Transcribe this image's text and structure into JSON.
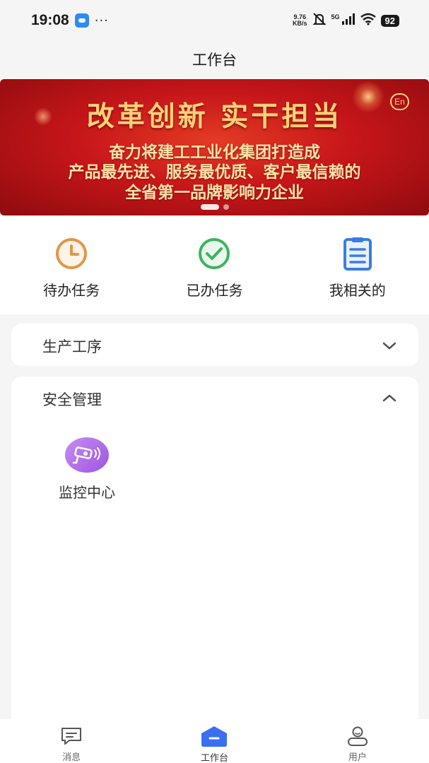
{
  "status_bar": {
    "time": "19:08",
    "more": "···",
    "net_speed_value": "9.76",
    "net_speed_unit": "KB/s",
    "network": "5G",
    "battery": "92"
  },
  "header": {
    "title": "工作台"
  },
  "banner": {
    "headline": "改革创新 实干担当",
    "lines": [
      "奋力将建工工业化集团打造成",
      "产品最先进、服务最优质、客户最信赖的",
      "全省第一品牌影响力企业"
    ],
    "lang_badge": "En",
    "active_slide": 1,
    "slide_count": 2
  },
  "quick_actions": [
    {
      "label": "待办任务",
      "icon": "clock-icon",
      "color": "#e0974a"
    },
    {
      "label": "已办任务",
      "icon": "check-circle-icon",
      "color": "#3cb45b"
    },
    {
      "label": "我相关的",
      "icon": "clipboard-list-icon",
      "color": "#3a7de0"
    }
  ],
  "sections": [
    {
      "title": "生产工序",
      "expanded": false
    },
    {
      "title": "安全管理",
      "expanded": true,
      "modules": [
        {
          "label": "监控中心",
          "icon": "surveillance-camera-icon"
        }
      ]
    }
  ],
  "bottom_nav": [
    {
      "label": "消息",
      "icon": "message-icon",
      "active": false
    },
    {
      "label": "工作台",
      "icon": "workbench-icon",
      "active": true,
      "accent": "#3a6ff0"
    },
    {
      "label": "用户",
      "icon": "user-icon",
      "active": false
    }
  ]
}
